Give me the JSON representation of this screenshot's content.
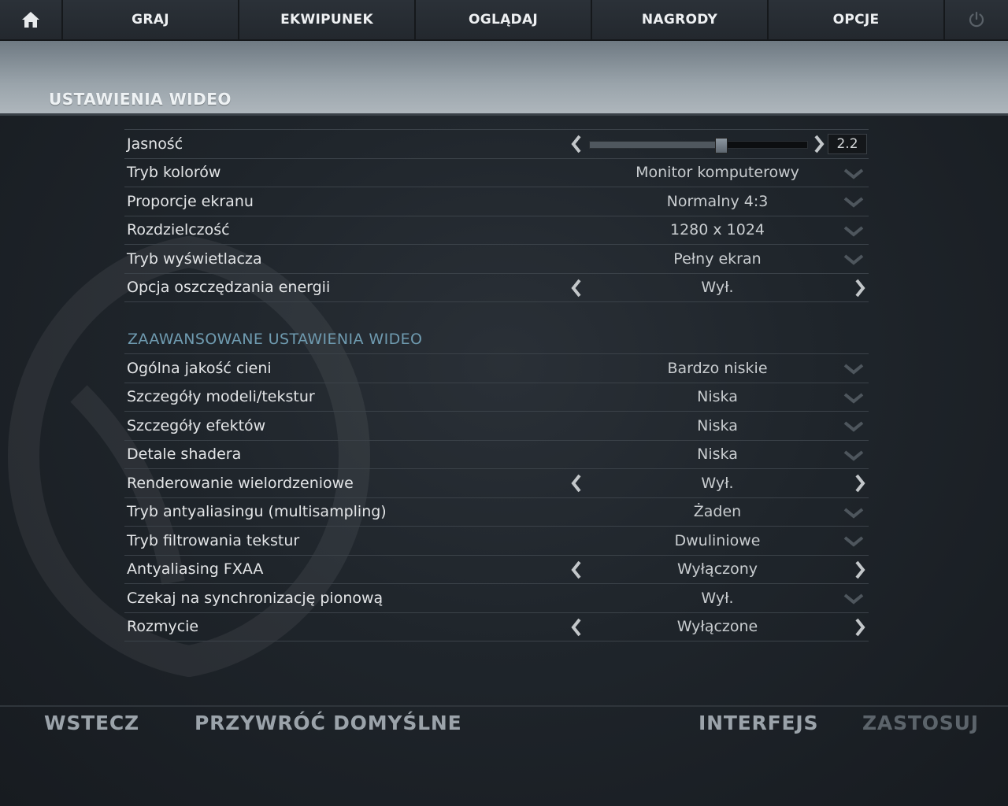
{
  "nav": {
    "items": [
      {
        "label": "GRAJ"
      },
      {
        "label": "EKWIPUNEK"
      },
      {
        "label": "OGLĄDAJ"
      },
      {
        "label": "NAGRODY"
      },
      {
        "label": "OPCJE"
      }
    ]
  },
  "header": {
    "title": "USTAWIENIA WIDEO"
  },
  "basic": {
    "brightness": {
      "label": "Jasność",
      "value": "2.2",
      "level": 0.6
    },
    "rows": [
      {
        "label": "Tryb kolorów",
        "value": "Monitor komputerowy",
        "control": "dropdown"
      },
      {
        "label": "Proporcje ekranu",
        "value": "Normalny 4:3",
        "control": "dropdown"
      },
      {
        "label": "Rozdzielczość",
        "value": "1280 x 1024",
        "control": "dropdown"
      },
      {
        "label": "Tryb wyświetlacza",
        "value": "Pełny ekran",
        "control": "dropdown"
      },
      {
        "label": "Opcja oszczędzania energii",
        "value": "Wył.",
        "control": "arrows"
      }
    ]
  },
  "advanced": {
    "title": "ZAAWANSOWANE USTAWIENIA WIDEO",
    "rows": [
      {
        "label": "Ogólna jakość cieni",
        "value": "Bardzo niskie",
        "control": "dropdown"
      },
      {
        "label": "Szczegóły modeli/tekstur",
        "value": "Niska",
        "control": "dropdown"
      },
      {
        "label": "Szczegóły efektów",
        "value": "Niska",
        "control": "dropdown"
      },
      {
        "label": "Detale shadera",
        "value": "Niska",
        "control": "dropdown"
      },
      {
        "label": "Renderowanie wielordzeniowe",
        "value": "Wył.",
        "control": "arrows"
      },
      {
        "label": "Tryb antyaliasingu (multisampling)",
        "value": "Żaden",
        "control": "dropdown"
      },
      {
        "label": "Tryb filtrowania tekstur",
        "value": "Dwuliniowe",
        "control": "dropdown"
      },
      {
        "label": "Antyaliasing FXAA",
        "value": "Wyłączony",
        "control": "arrows"
      },
      {
        "label": "Czekaj na synchronizację pionową",
        "value": "Wył.",
        "control": "dropdown"
      },
      {
        "label": "Rozmycie",
        "value": "Wyłączone",
        "control": "arrows"
      }
    ]
  },
  "footer": {
    "back": "WSTECZ",
    "restore": "PRZYWRÓĆ DOMYŚLNE",
    "interface": "INTERFEJS",
    "apply": "ZASTOSUJ"
  },
  "icons": {
    "home": "home-icon",
    "power": "power-icon",
    "dropdown": "chevron-down-icon",
    "left": "arrow-left-icon",
    "right": "arrow-right-icon"
  },
  "colors": {
    "accent_section_title": "#6f9bb0",
    "header_band": "#9aa4ab"
  }
}
